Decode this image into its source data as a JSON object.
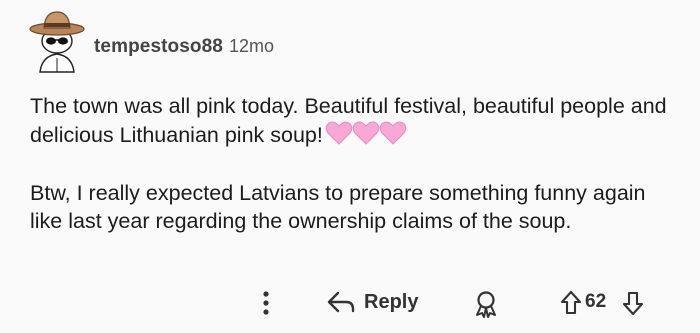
{
  "comment": {
    "username": "tempestoso88",
    "age": "12mo",
    "paragraph1": "The town was all pink today. Beautiful festival, beautiful people and delicious Lithuanian pink soup!",
    "paragraph2": "Btw, I really expected Latvians to prepare something funny again like last year regarding the ownership claims of the soup."
  },
  "actions": {
    "reply_label": "Reply",
    "score": "62"
  },
  "icons": {
    "more": "more-options-icon",
    "reply": "reply-arrow-icon",
    "award": "award-icon",
    "upvote": "upvote-arrow-icon",
    "downvote": "downvote-arrow-icon",
    "hearts": "pink-heart-emoji"
  },
  "colors": {
    "background": "#fafafa",
    "heart": "#f7a8d4"
  }
}
